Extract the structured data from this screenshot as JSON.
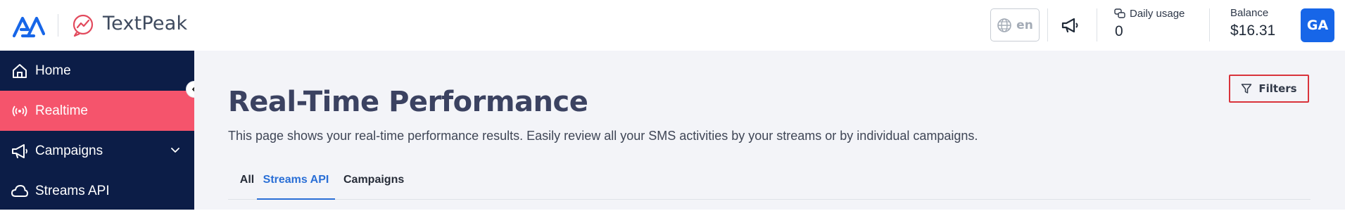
{
  "header": {
    "brand_name": "TextPeak",
    "language": "en",
    "daily_usage_label": "Daily usage",
    "daily_usage_value": "0",
    "balance_label": "Balance",
    "balance_value": "$16.31",
    "avatar_initials": "GA"
  },
  "sidebar": {
    "items": [
      {
        "label": "Home",
        "icon": "home-icon"
      },
      {
        "label": "Realtime",
        "icon": "broadcast-icon",
        "active": true
      },
      {
        "label": "Campaigns",
        "icon": "megaphone-icon",
        "has_submenu": true
      },
      {
        "label": "Streams API",
        "icon": "cloud-icon"
      }
    ]
  },
  "main": {
    "filters_label": "Filters",
    "title": "Real-Time Performance",
    "description": "This page shows your real-time performance results. Easily review all your SMS activities by your streams or by individual campaigns.",
    "tabs": [
      {
        "label": "All"
      },
      {
        "label": "Streams API",
        "active": true
      },
      {
        "label": "Campaigns"
      }
    ]
  },
  "colors": {
    "sidebar_bg": "#0c1d47",
    "active_item": "#f5546c",
    "accent_blue": "#1766e8",
    "filters_outline": "#d9333b"
  }
}
